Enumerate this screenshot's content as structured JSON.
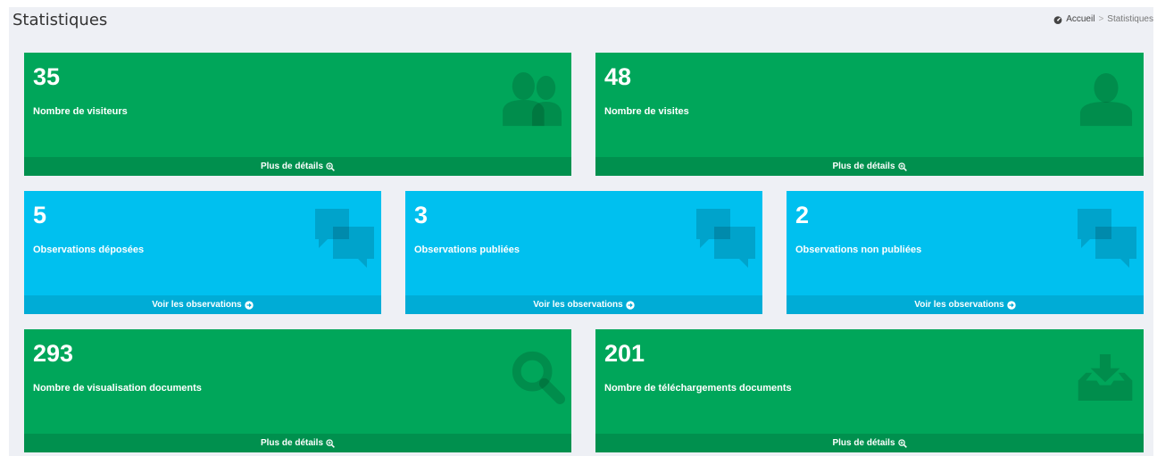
{
  "header": {
    "title": "Statistiques",
    "breadcrumb": {
      "home": "Accueil",
      "separator": ">",
      "current": "Statistiques"
    }
  },
  "colors": {
    "green": "#00a65a",
    "green_footer": "#00904e",
    "aqua": "#00c0ef",
    "aqua_footer": "#00acd6"
  },
  "boxes": [
    {
      "count": "35",
      "label": "Nombre de visiteurs",
      "footer": "Plus de détails",
      "icon": "users-icon",
      "footer_icon": "zoom-in-icon"
    },
    {
      "count": "48",
      "label": "Nombre de visites",
      "footer": "Plus de détails",
      "icon": "user-icon",
      "footer_icon": "zoom-in-icon"
    },
    {
      "count": "5",
      "label": "Observations déposées",
      "footer": "Voir les observations",
      "icon": "comments-icon",
      "footer_icon": "arrow-circle-right-icon"
    },
    {
      "count": "3",
      "label": "Observations publiées",
      "footer": "Voir les observations",
      "icon": "comments-icon",
      "footer_icon": "arrow-circle-right-icon"
    },
    {
      "count": "2",
      "label": "Observations non publiées",
      "footer": "Voir les observations",
      "icon": "comments-icon",
      "footer_icon": "arrow-circle-right-icon"
    },
    {
      "count": "293",
      "label": "Nombre de visualisation documents",
      "footer": "Plus de détails",
      "icon": "search-icon",
      "footer_icon": "zoom-in-icon"
    },
    {
      "count": "201",
      "label": "Nombre de téléchargements documents",
      "footer": "Plus de détails",
      "icon": "download-icon",
      "footer_icon": "zoom-in-icon"
    }
  ]
}
